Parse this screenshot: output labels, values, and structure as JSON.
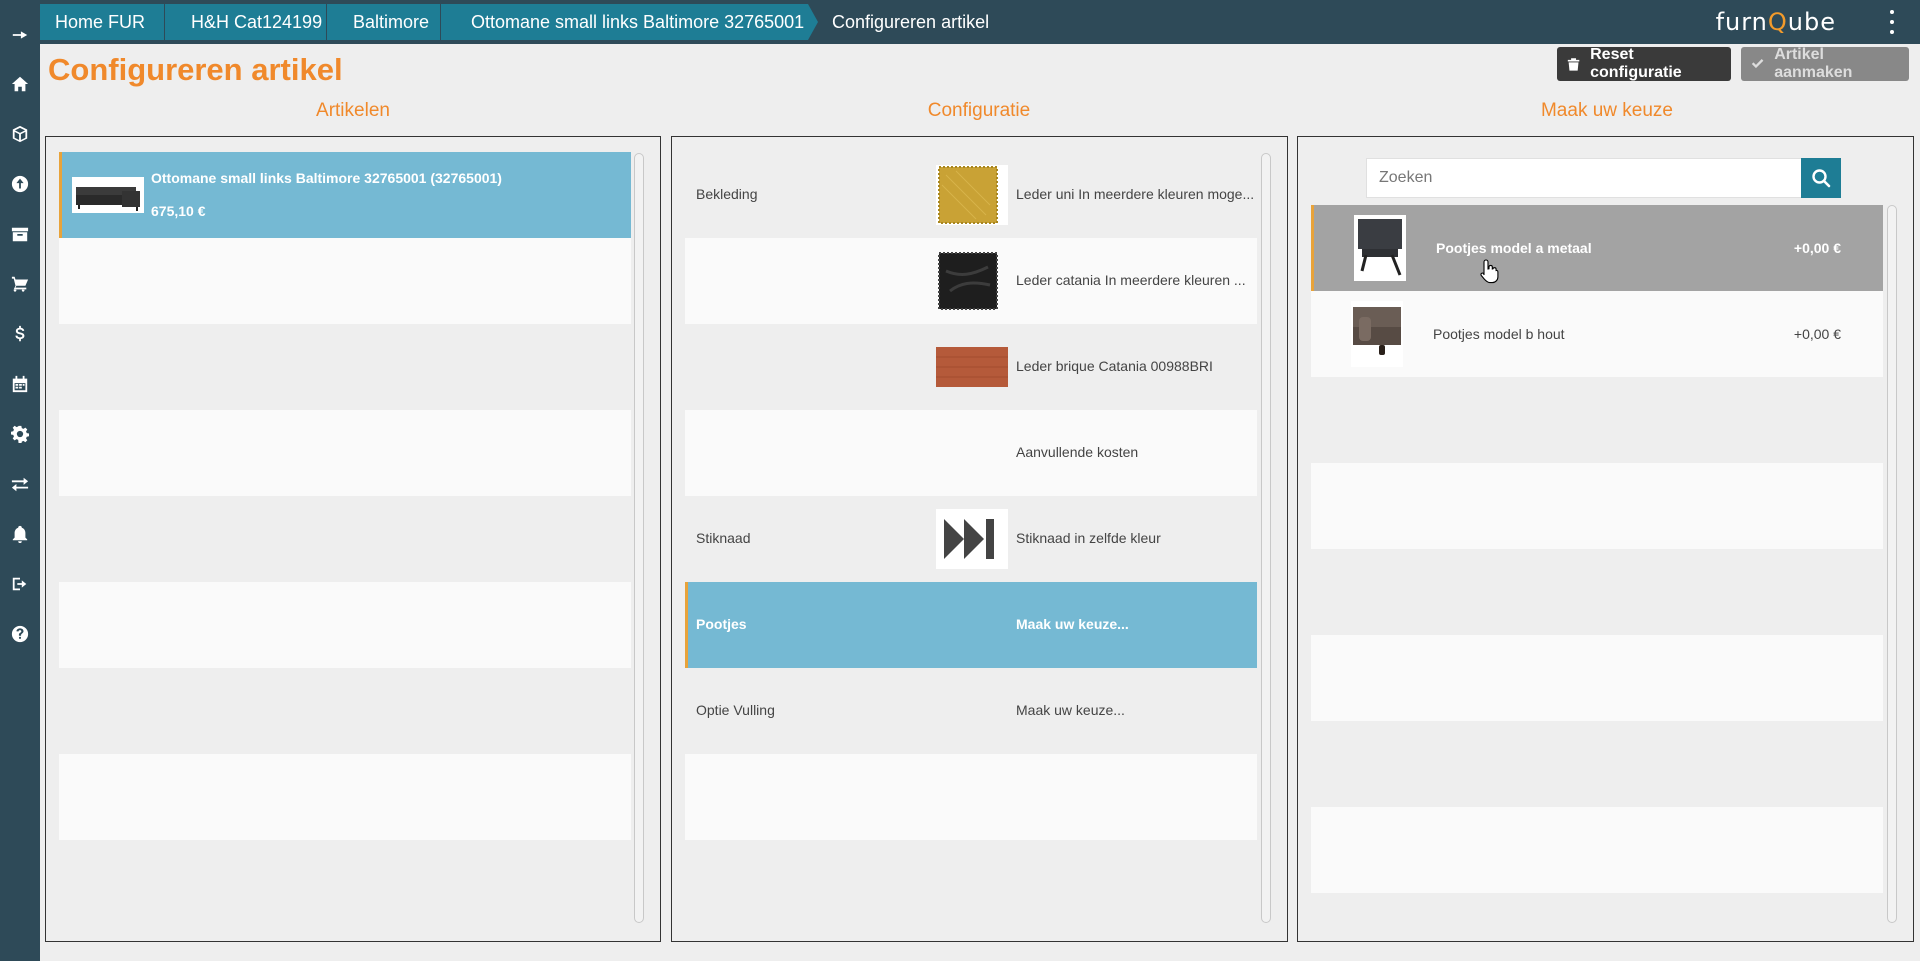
{
  "breadcrumbs": [
    {
      "label": "Home FUR"
    },
    {
      "label": "H&H Cat124199"
    },
    {
      "label": "Baltimore"
    },
    {
      "label": "Ottomane small links Baltimore 32765001"
    },
    {
      "label": "Configureren artikel"
    }
  ],
  "logo": {
    "prefix": "furn",
    "highlight": "Q",
    "suffix": "ube"
  },
  "page_title": "Configureren artikel",
  "buttons": {
    "reset": "Reset configuratie",
    "create": "Artikel aanmaken"
  },
  "columns": {
    "articles": "Artikelen",
    "configuration": "Configuratie",
    "choices": "Maak uw keuze"
  },
  "articles": [
    {
      "name": "Ottomane small links Baltimore 32765001 (32765001)",
      "price": "675,10 €",
      "selected": true
    }
  ],
  "configuration": [
    {
      "label": "Bekleding",
      "value": "Leder uni In meerdere kleuren moge...",
      "swatch": "yellow-leather"
    },
    {
      "label": "",
      "value": "Leder catania In meerdere kleuren ...",
      "swatch": "black-leather"
    },
    {
      "label": "",
      "value": "Leder brique Catania 00988BRI",
      "swatch": "brick-leather"
    },
    {
      "label": "",
      "value": "Aanvullende kosten",
      "swatch": ""
    },
    {
      "label": "Stiknaad",
      "value": "Stiknaad in zelfde kleur",
      "swatch": "fast-forward-icon"
    },
    {
      "label": "Pootjes",
      "value": "Maak uw keuze...",
      "swatch": "",
      "selected": true
    },
    {
      "label": "Optie Vulling",
      "value": "Maak uw keuze...",
      "swatch": ""
    }
  ],
  "search": {
    "placeholder": "Zoeken",
    "value": ""
  },
  "choices": [
    {
      "name": "Pootjes model a metaal",
      "price": "+0,00 €",
      "selected": true
    },
    {
      "name": "Pootjes model b hout",
      "price": "+0,00 €"
    }
  ],
  "colors": {
    "sidebar": "#2e4a58",
    "accent_orange": "#f0892b",
    "accent_blue": "#1e7d95",
    "selection_blue": "#75b9d3",
    "selection_grey": "#a3a3a3"
  }
}
